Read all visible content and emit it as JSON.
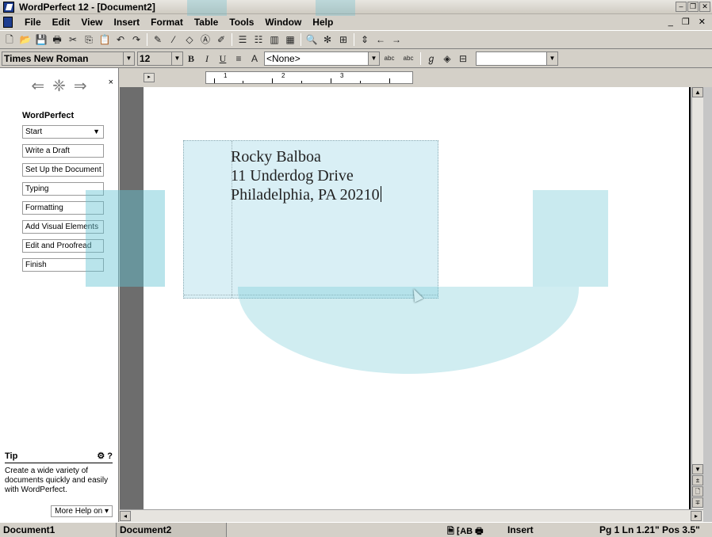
{
  "window": {
    "title": "WordPerfect 12 - [Document2]"
  },
  "menu": [
    "File",
    "Edit",
    "View",
    "Insert",
    "Format",
    "Table",
    "Tools",
    "Window",
    "Help"
  ],
  "toolbar": {
    "icons": [
      "new-icon",
      "open-icon",
      "save-icon",
      "print-icon",
      "cut-icon",
      "copy-icon",
      "paste-icon",
      "undo-icon",
      "redo-icon",
      "highlight-icon",
      "drawline-icon",
      "shape-icon",
      "text-box-icon",
      "clipart-icon",
      "bullet-list-icon",
      "numbered-list-icon",
      "columns-icon",
      "table-icon",
      "zoom-icon",
      "spellcheck-icon",
      "back-icon",
      "forward-icon"
    ]
  },
  "property_bar": {
    "font_name": "Times New Roman",
    "font_size": "12",
    "bold_label": "B",
    "italic_label": "I",
    "underline_label": "U",
    "style_value": "<None>",
    "abc_label_1": "abc",
    "abc_label_2": "abc"
  },
  "left_pane": {
    "heading": "WordPerfect",
    "items": [
      {
        "label": "Start"
      },
      {
        "label": "Write a Draft"
      },
      {
        "label": "Set Up the Document"
      },
      {
        "label": "Typing"
      },
      {
        "label": "Formatting"
      },
      {
        "label": "Add Visual Elements"
      },
      {
        "label": "Edit and Proofread"
      },
      {
        "label": "Finish"
      }
    ],
    "tip_heading": "Tip",
    "tip_text": "Create a wide variety of documents quickly and easily with WordPerfect.",
    "more_help": "More Help on"
  },
  "ruler": {
    "numbers": [
      "1",
      "2",
      "3"
    ]
  },
  "document": {
    "address_line_1": "Rocky Balboa",
    "address_line_2": "11 Underdog Drive",
    "address_line_3": "Philadelphia, PA 20210"
  },
  "status": {
    "doc1": "Document1",
    "doc2": "Document2",
    "ab_label": "AB",
    "mode": "Insert",
    "position": "Pg 1 Ln 1.21\" Pos 3.5\""
  },
  "colors": {
    "envelope": "#d9eff5",
    "watermark": "#64c3d2",
    "chrome": "#d4d0c8"
  }
}
